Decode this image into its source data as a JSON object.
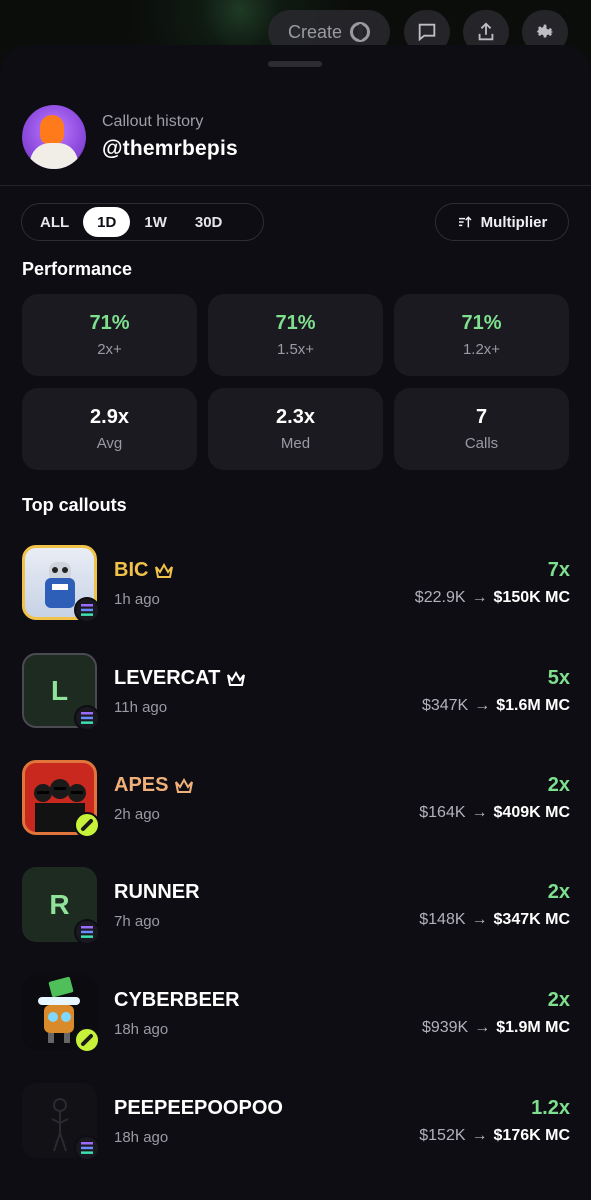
{
  "topbar": {
    "create_label": "Create"
  },
  "header": {
    "subtitle": "Callout history",
    "username": "@themrbepis"
  },
  "filters": {
    "options": [
      "ALL",
      "1D",
      "1W",
      "30D"
    ],
    "selected": "1D"
  },
  "multiplier_button": {
    "label": "Multiplier"
  },
  "performance": {
    "title": "Performance",
    "stats": [
      {
        "value": "71%",
        "label": "2x+"
      },
      {
        "value": "71%",
        "label": "1.5x+"
      },
      {
        "value": "71%",
        "label": "1.2x+"
      },
      {
        "value": "2.9x",
        "label": "Avg"
      },
      {
        "value": "2.3x",
        "label": "Med"
      },
      {
        "value": "7",
        "label": "Calls"
      }
    ]
  },
  "top_callouts": {
    "title": "Top callouts",
    "items": [
      {
        "name": "BIC",
        "time": "1h ago",
        "multiplier": "7x",
        "mc_from": "$22.9K",
        "mc_to": "$150K MC",
        "name_color": "#f0c24a",
        "crown": true,
        "chain": "solana-icon"
      },
      {
        "name": "LEVERCAT",
        "time": "11h ago",
        "multiplier": "5x",
        "mc_from": "$347K",
        "mc_to": "$1.6M MC",
        "name_color": "#ffffff",
        "crown": true,
        "letter": "L",
        "chain": "solana-icon"
      },
      {
        "name": "APES",
        "time": "2h ago",
        "multiplier": "2x",
        "mc_from": "$164K",
        "mc_to": "$409K MC",
        "name_color": "#f0b07a",
        "crown": true,
        "chain": "pump-icon"
      },
      {
        "name": "RUNNER",
        "time": "7h ago",
        "multiplier": "2x",
        "mc_from": "$148K",
        "mc_to": "$347K MC",
        "name_color": "#ffffff",
        "crown": false,
        "letter": "R",
        "chain": "solana-icon"
      },
      {
        "name": "CYBERBEER",
        "time": "18h ago",
        "multiplier": "2x",
        "mc_from": "$939K",
        "mc_to": "$1.9M MC",
        "name_color": "#ffffff",
        "crown": false,
        "chain": "pump-icon"
      },
      {
        "name": "PEEPEEPOOPOO",
        "time": "18h ago",
        "multiplier": "1.2x",
        "mc_from": "$152K",
        "mc_to": "$176K MC",
        "name_color": "#ffffff",
        "crown": false,
        "chain": "solana-icon"
      }
    ]
  },
  "colors": {
    "accent_green": "#7ee08f",
    "gold": "#f0c24a",
    "orange": "#f0b07a"
  }
}
